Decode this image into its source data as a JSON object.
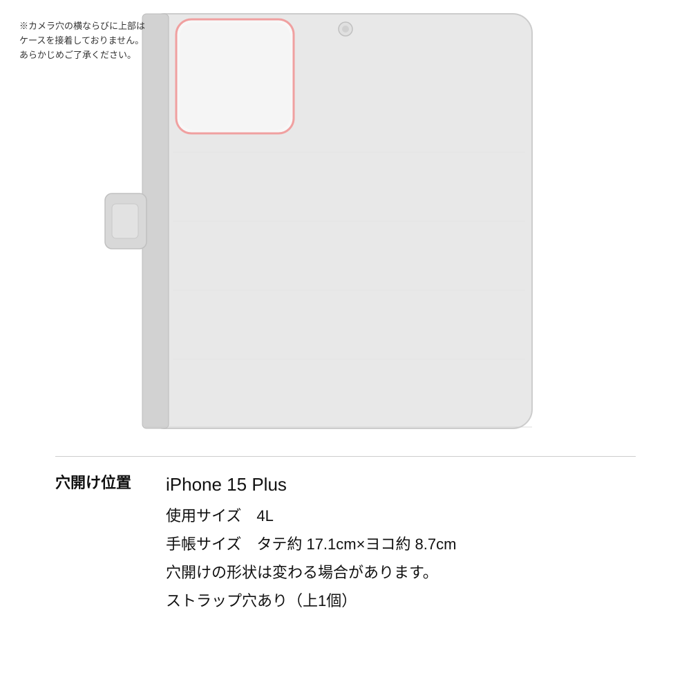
{
  "note": {
    "line1": "※カメラ穴の横ならびに上部は",
    "line2": "ケースを接着しておりません。",
    "line3": "あらかじめご了承ください。"
  },
  "label": {
    "hole_position": "穴開け位置"
  },
  "product": {
    "model": "iPhone 15 Plus",
    "size_label": "使用サイズ　4L",
    "notebook_size": "手帳サイズ　タテ約 17.1cm×ヨコ約 8.7cm",
    "hole_shape": "穴開けの形状は変わる場合があります。",
    "strap": "ストラップ穴あり（上1個）"
  },
  "colors": {
    "case_body": "#e8e8e8",
    "case_spine": "#d0d0d0",
    "case_tab": "#d8d8d8",
    "camera_cutout": "#f5f5f5",
    "camera_border": "#f0a0a0",
    "hole_dot": "#cccccc",
    "background": "#ffffff"
  }
}
